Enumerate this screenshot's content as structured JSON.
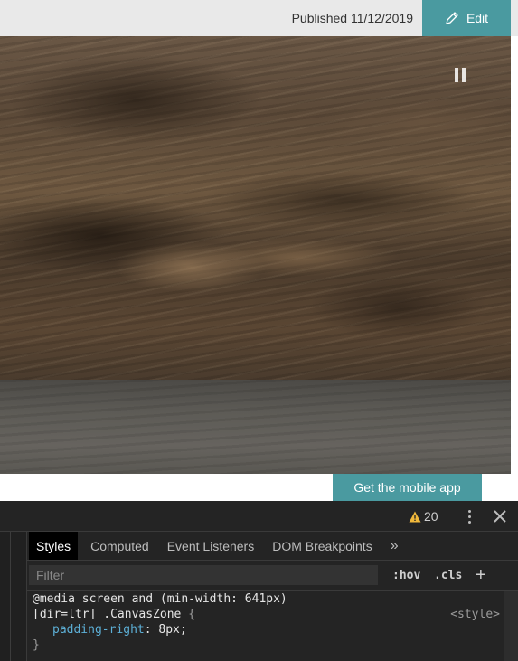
{
  "header": {
    "published": "Published 11/12/2019",
    "edit_label": "Edit"
  },
  "hero": {
    "pause_label": "Pause"
  },
  "footer": {
    "mobile_app_label": "Get the mobile app"
  },
  "devtools": {
    "warning_count": "20",
    "tabs": [
      "Styles",
      "Computed",
      "Event Listeners",
      "DOM Breakpoints"
    ],
    "more_tabs": "»",
    "filter_placeholder": "Filter",
    "hov_label": ":hov",
    "cls_label": ".cls",
    "add_label": "+",
    "rule": {
      "media": "@media screen and (min-width: 641px)",
      "selector": "[dir=ltr] .CanvasZone",
      "open_brace": "{",
      "property": "padding-right",
      "value": "8px;",
      "close_brace": "}",
      "source": "<style>"
    }
  },
  "colors": {
    "accent": "#4a9aa0",
    "devtools_bg": "#242424",
    "property": "#5db0d7"
  }
}
